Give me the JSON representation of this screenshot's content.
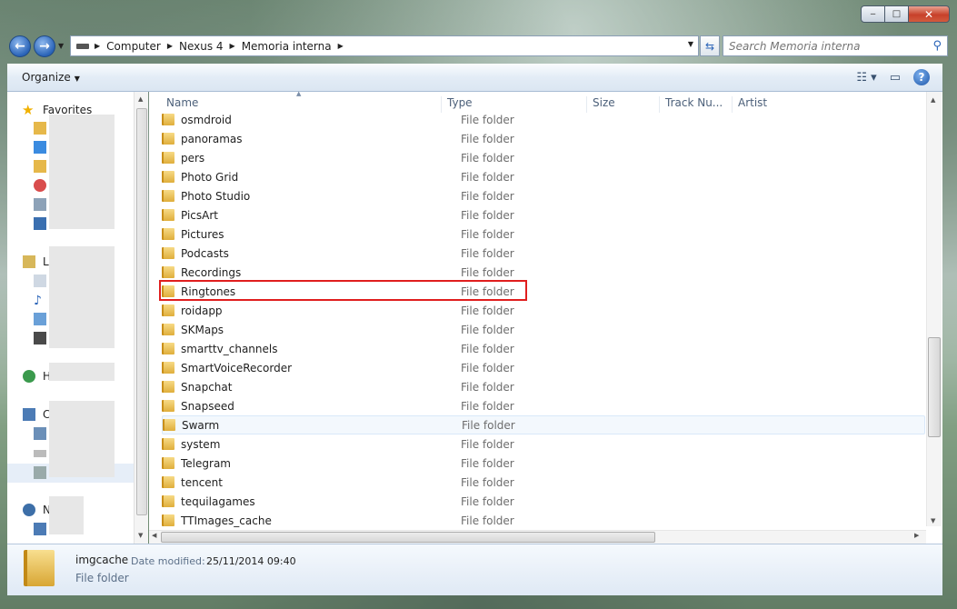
{
  "window": {
    "minimize": "‒",
    "maximize": "□",
    "close": "✕"
  },
  "navigation": {
    "breadcrumb": [
      "Computer",
      "Nexus 4",
      "Memoria interna"
    ],
    "search_placeholder": "Search Memoria interna"
  },
  "toolbar": {
    "organize_label": "Organize"
  },
  "sidebar": {
    "favorites_label": "Favorites",
    "group_libraries_initial": "L",
    "group_homegroup_initial": "H",
    "group_computer_initial": "C",
    "group_network_initial": "N"
  },
  "columns": {
    "name": "Name",
    "type": "Type",
    "size": "Size",
    "track": "Track Nu...",
    "artist": "Artist"
  },
  "files": [
    {
      "name": "osmdroid",
      "type": "File folder"
    },
    {
      "name": "panoramas",
      "type": "File folder"
    },
    {
      "name": "pers",
      "type": "File folder"
    },
    {
      "name": "Photo Grid",
      "type": "File folder"
    },
    {
      "name": "Photo Studio",
      "type": "File folder"
    },
    {
      "name": "PicsArt",
      "type": "File folder"
    },
    {
      "name": "Pictures",
      "type": "File folder"
    },
    {
      "name": "Podcasts",
      "type": "File folder"
    },
    {
      "name": "Recordings",
      "type": "File folder"
    },
    {
      "name": "Ringtones",
      "type": "File folder"
    },
    {
      "name": "roidapp",
      "type": "File folder"
    },
    {
      "name": "SKMaps",
      "type": "File folder"
    },
    {
      "name": "smarttv_channels",
      "type": "File folder"
    },
    {
      "name": "SmartVoiceRecorder",
      "type": "File folder"
    },
    {
      "name": "Snapchat",
      "type": "File folder"
    },
    {
      "name": "Snapseed",
      "type": "File folder"
    },
    {
      "name": "Swarm",
      "type": "File folder"
    },
    {
      "name": "system",
      "type": "File folder"
    },
    {
      "name": "Telegram",
      "type": "File folder"
    },
    {
      "name": "tencent",
      "type": "File folder"
    },
    {
      "name": "tequilagames",
      "type": "File folder"
    },
    {
      "name": "TTImages_cache",
      "type": "File folder"
    }
  ],
  "details": {
    "name": "imgcache",
    "date_label": "Date modified:",
    "date_value": "25/11/2014 09:40",
    "kind": "File folder"
  },
  "colors": {
    "highlight_border": "#e01e1e",
    "accent": "#2a64b8"
  }
}
